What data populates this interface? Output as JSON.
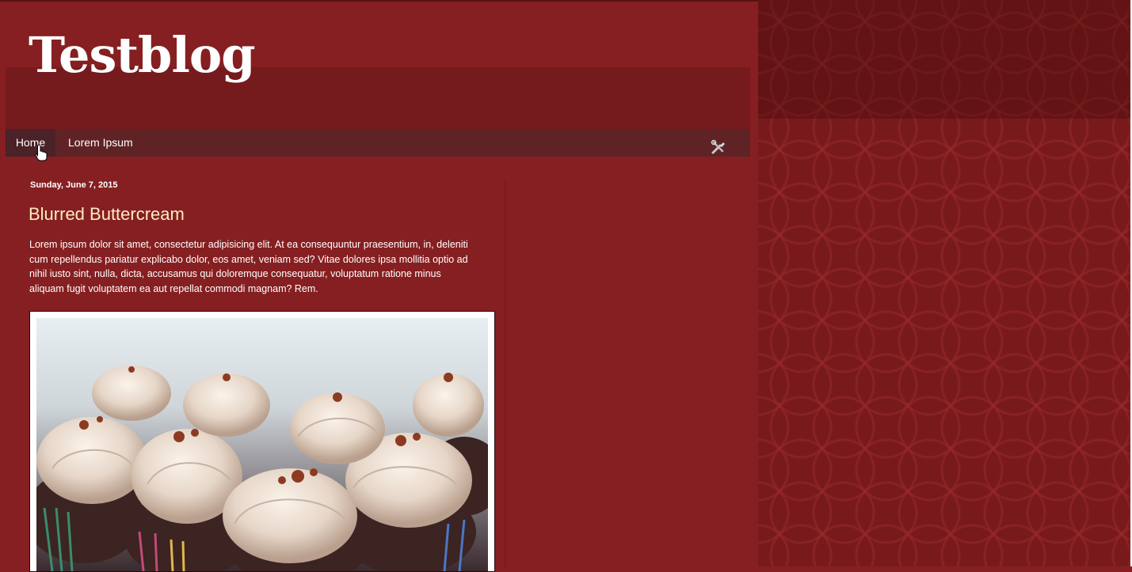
{
  "blog": {
    "title": "Testblog"
  },
  "nav": {
    "tabs": [
      {
        "label": "Home",
        "active": true
      },
      {
        "label": "Lorem Ipsum",
        "active": false
      }
    ],
    "tools_icon": "wrench-screwdriver-icon"
  },
  "post": {
    "date": "Sunday, June 7, 2015",
    "title": "Blurred Buttercream",
    "body": "Lorem ipsum dolor sit amet, consectetur adipisicing elit. At ea consequuntur praesentium, in, deleniti cum repellendus pariatur explicabo dolor, eos amet, veniam sed? Vitae dolores ipsa mollitia optio ad nihil iusto sint, nulla, dicta, accusamus qui doloremque consequatur, voluptatum ratione minus aliquam fugit voluptatem ea aut repellat commodi magnam? Rem.",
    "image": "cupcakes-photo"
  },
  "colors": {
    "background": "#861f21",
    "title_accent": "#fcebc3",
    "tab_bar": "#5f2326"
  }
}
